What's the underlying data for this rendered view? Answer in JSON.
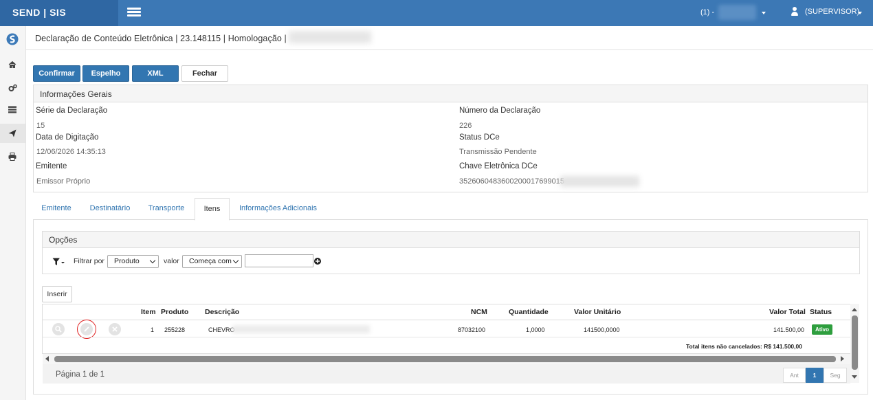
{
  "app": {
    "brand": "SEND | SIS"
  },
  "topbar": {
    "unit_label": "(1) -",
    "user_label": "(SUPERVISOR)"
  },
  "header": {
    "title": "Declaração de Conteúdo Eletrônica | 23.148115 | Homologação |"
  },
  "toolbar": {
    "confirm": "Confirmar",
    "mirror": "Espelho",
    "xml": "XML",
    "close": "Fechar"
  },
  "info": {
    "heading": "Informações Gerais",
    "serie_label": "Série da Declaração",
    "serie_value": "15",
    "numero_label": "Número da Declaração",
    "numero_value": "226",
    "data_label": "Data de Digitação",
    "data_value": "12/06/2026 14:35:13",
    "status_label": "Status DCe",
    "status_value": "Transmissão Pendente",
    "emitente_label": "Emitente",
    "emitente_value": "Emissor Próprio",
    "chave_label": "Chave Eletrônica DCe",
    "chave_value": "3526060483600200017699015"
  },
  "tabs": [
    "Emitente",
    "Destinatário",
    "Transporte",
    "Itens",
    "Informações Adicionais"
  ],
  "options": {
    "heading": "Opções",
    "filter_label": "Filtrar por",
    "filter_value": "Produto",
    "valor_label": "valor",
    "match_value": "Começa com",
    "insert": "Inserir"
  },
  "grid": {
    "headers": {
      "item": "Item",
      "produto": "Produto",
      "descricao": "Descrição",
      "ncm": "NCM",
      "quantidade": "Quantidade",
      "valor_unitario": "Valor Unitário",
      "valor_total": "Valor Total",
      "status": "Status"
    },
    "row": {
      "item": "1",
      "produto": "255228",
      "descricao": "CHEVRO",
      "ncm": "87032100",
      "quantidade": "1,0000",
      "valor_unitario": "141500,0000",
      "valor_total": "141.500,00",
      "status": "Ativo"
    },
    "total": "Total itens não cancelados: R$ 141.500,00"
  },
  "pager": {
    "info": "Página 1 de 1",
    "prev": "Ant",
    "page": "1",
    "next": "Seg"
  },
  "colors": {
    "topbar": "#3c78b5",
    "primary": "#3276b1",
    "badge": "#2e9e3e",
    "highlight": "#e02020"
  }
}
